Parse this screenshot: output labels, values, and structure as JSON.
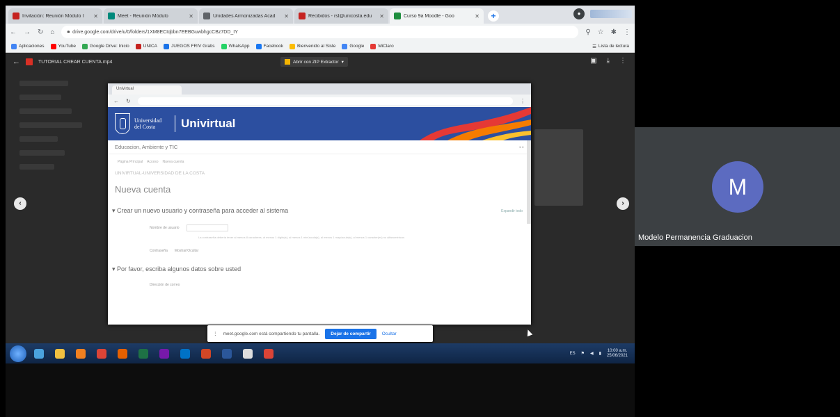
{
  "browser": {
    "tabs": [
      {
        "label": "Invitación: Reunión Módulo I",
        "color": "#c5221f",
        "active": false
      },
      {
        "label": "Meet - Reunión Módulo",
        "color": "#00897b",
        "active": false
      },
      {
        "label": "Unidades Armonizadas Acad",
        "color": "#5f6368",
        "active": false
      },
      {
        "label": "Recibidos - rsl@unicosta.edu",
        "color": "#c5221f",
        "active": false
      },
      {
        "label": "Curso 9a Moodle - Goo",
        "color": "#1e8e3e",
        "active": true
      }
    ],
    "new_tab": "+",
    "url": "drive.google.com/drive/u/0/folders/1XM8ECIqbbn7EEBGuwbhgcCBz7DD_IY",
    "bookmarks": [
      "Aplicaciones",
      "YouTube",
      "Google Drive: Inicio",
      "UNICA",
      "JUEGOS FRIV Gratis",
      "WhatsApp",
      "Facebook",
      "Bienvenido al Siste",
      "Google",
      "MiClaro"
    ],
    "bookmark_colors": [
      "#4285f4",
      "#ff0000",
      "#34a853",
      "#c5221f",
      "#1a73e8",
      "#25d366",
      "#1877f2",
      "#fbbc04",
      "#4285f4",
      "#e53935"
    ],
    "reading_list": "Lista de lectura"
  },
  "viewer": {
    "file_name": "TUTORIAL CREAR CUENTA.mp4",
    "open_with": "Abrir con ZIP Extractor"
  },
  "video": {
    "tab_title": "Univirtual",
    "university": "Universidad del Costa",
    "brand": "Univirtual",
    "subheading": "Educacion, Ambiente y TIC",
    "breadcrumbs": [
      "Página Principal",
      "Acceso",
      "Nueva cuenta"
    ],
    "site_title": "UNIVIRTUAL-UNIVERSIDAD DE LA COSTA",
    "heading": "Nueva cuenta",
    "expand_all": "Expandir todo",
    "section1": "Crear un nuevo usuario y contraseña para acceder al sistema",
    "field_username": "Nombre de usuario",
    "help_text": "La contraseña debería tener al menos 8 caracteres, al menos 1 dígito(s), al menos 1 minúscula(s), al menos 1 mayúscula(s), al menos 1 caracter(es) no alfanuméricos",
    "field_password": "Contraseña",
    "show_password": "Mostrar/Ocultar",
    "section2": "Por favor, escriba algunos datos sobre usted",
    "field_email": "Dirección de correo"
  },
  "share_notice": {
    "text": "meet.google.com está compartiendo tu pantalla.",
    "stop": "Dejar de compartir",
    "hide": "Ocultar"
  },
  "taskbar": {
    "apps": [
      "explorer",
      "folder",
      "media",
      "chrome",
      "firefox",
      "excel",
      "onenote",
      "outlook",
      "powerpoint",
      "word",
      "app",
      "chrome"
    ],
    "app_colors": [
      "#4aa3df",
      "#f0c040",
      "#f08020",
      "#db4437",
      "#e66000",
      "#1e7145",
      "#7719aa",
      "#0072c6",
      "#d24726",
      "#2b579a",
      "#ddd",
      "#db4437"
    ],
    "time": "10:00 a.m.",
    "date": "25/06/2021"
  },
  "participant": {
    "initial": "M",
    "name": "Modelo Permanencia Graduacion",
    "avatar_color": "#5c6bc0"
  }
}
